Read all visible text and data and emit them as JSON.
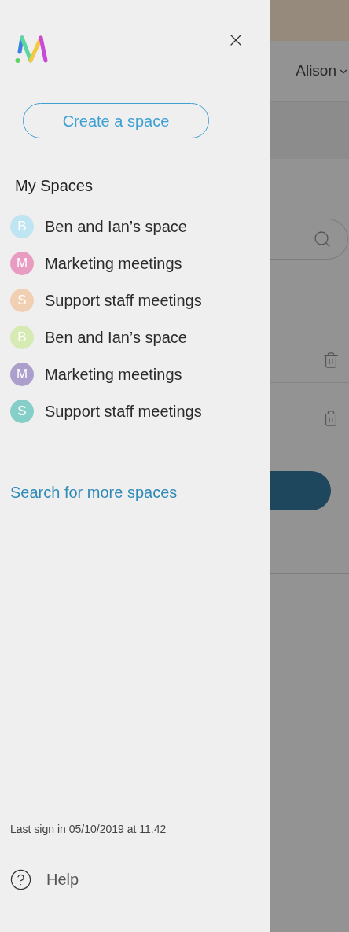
{
  "drawer": {
    "create_button": "Create a space",
    "section_title": "My Spaces",
    "spaces": [
      {
        "initial": "B",
        "name": "Ben and Ian’s space",
        "color": "#bfe4f2"
      },
      {
        "initial": "M",
        "name": "Marketing meetings",
        "color": "#e89cc1"
      },
      {
        "initial": "S",
        "name": "Support staff meetings",
        "color": "#f1cfb3"
      },
      {
        "initial": "B",
        "name": "Ben and Ian’s space",
        "color": "#d6ebb3"
      },
      {
        "initial": "M",
        "name": "Marketing meetings",
        "color": "#ad9fcc"
      },
      {
        "initial": "S",
        "name": "Support staff meetings",
        "color": "#86cfc8"
      }
    ],
    "search_link": "Search for more spaces",
    "last_sign_in": "Last sign in 05/10/2019 at 11.42",
    "help": "Help"
  },
  "background_page": {
    "user_menu": "Alison"
  }
}
